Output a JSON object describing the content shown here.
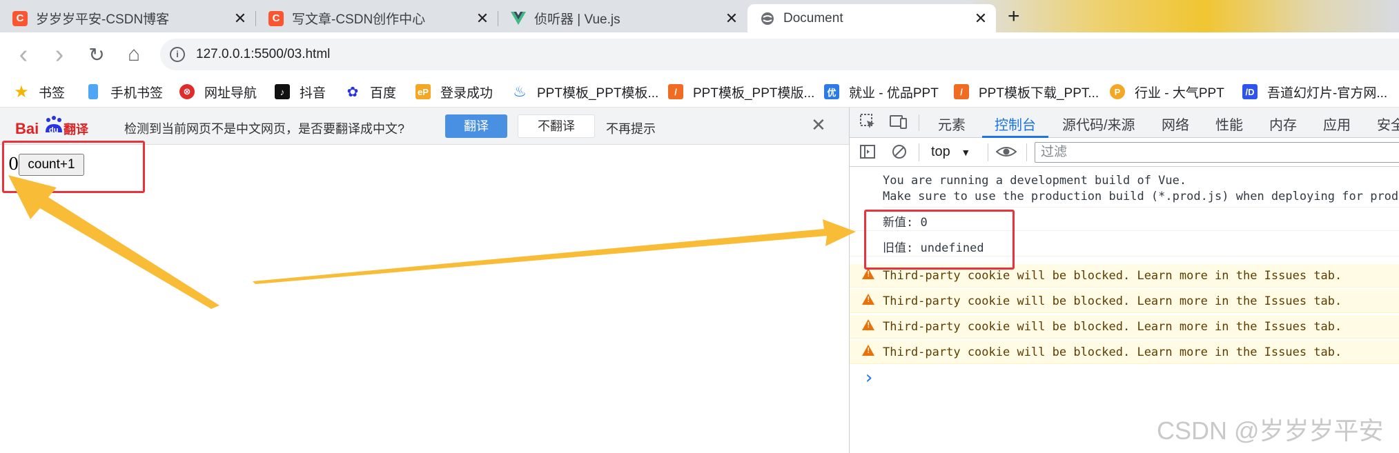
{
  "tabs": [
    {
      "title": "岁岁岁平安-CSDN博客",
      "icon": "csdn-icon",
      "icon_text": "C"
    },
    {
      "title": "写文章-CSDN创作中心",
      "icon": "csdn-icon",
      "icon_text": "C"
    },
    {
      "title": "侦听器 | Vue.js",
      "icon": "vue-icon",
      "icon_text": ""
    },
    {
      "title": "Document",
      "icon": "globe-icon",
      "icon_text": ""
    }
  ],
  "new_tab_symbol": "+",
  "close_symbol": "✕",
  "address_bar": {
    "url": "127.0.0.1:5500/03.html",
    "info_symbol": "i"
  },
  "nav_symbols": {
    "back": "‹",
    "forward": "›",
    "reload": "↻",
    "home": "⌂"
  },
  "bookmarks": [
    {
      "label": "书签",
      "icon": "star-icon"
    },
    {
      "label": "手机书签",
      "icon": "phone-icon"
    },
    {
      "label": "网址导航",
      "icon": "navigation-icon"
    },
    {
      "label": "抖音",
      "icon": "douyin-icon"
    },
    {
      "label": "百度",
      "icon": "baidu-icon"
    },
    {
      "label": "登录成功",
      "icon": "ep-icon"
    },
    {
      "label": "PPT模板_PPT模板...",
      "icon": "ppt-icon"
    },
    {
      "label": "PPT模板_PPT模版...",
      "icon": "ppt-icon"
    },
    {
      "label": "就业 - 优品PPT",
      "icon": "youpin-icon"
    },
    {
      "label": "PPT模板下载_PPT...",
      "icon": "ppt-icon"
    },
    {
      "label": "行业 - 大气PPT",
      "icon": "p-icon"
    },
    {
      "label": "吾道幻灯片-官方网...",
      "icon": "wudao-icon"
    }
  ],
  "translate_bar": {
    "logo_text": "Bai du 翻译",
    "message": "检测到当前网页不是中文网页，是否要翻译成中文?",
    "translate_label": "翻译",
    "no_translate_label": "不翻译",
    "never_label": "不再提示"
  },
  "page": {
    "count_value": "0",
    "button_label": "count+1"
  },
  "devtools": {
    "tabs": [
      "元素",
      "控制台",
      "源代码/来源",
      "网络",
      "性能",
      "内存",
      "应用",
      "安全"
    ],
    "active_tab": "控制台",
    "context": "top",
    "filter_placeholder": "过滤",
    "console": {
      "info_lines": [
        "You are running a development build of Vue.",
        "Make sure to use the production build (*.prod.js) when deploying for production."
      ],
      "logs": [
        "新值: 0",
        "旧值: undefined"
      ],
      "warnings": [
        "Third-party cookie will be blocked. Learn more in the Issues tab.",
        "Third-party cookie will be blocked. Learn more in the Issues tab.",
        "Third-party cookie will be blocked. Learn more in the Issues tab.",
        "Third-party cookie will be blocked. Learn more in the Issues tab."
      ],
      "prompt_symbol": "›"
    }
  },
  "watermark": "CSDN @岁岁岁平安",
  "colors": {
    "annotation_red": "#e8323c",
    "arrow_yellow": "#f9bc36",
    "accent_blue": "#1a73e8"
  }
}
